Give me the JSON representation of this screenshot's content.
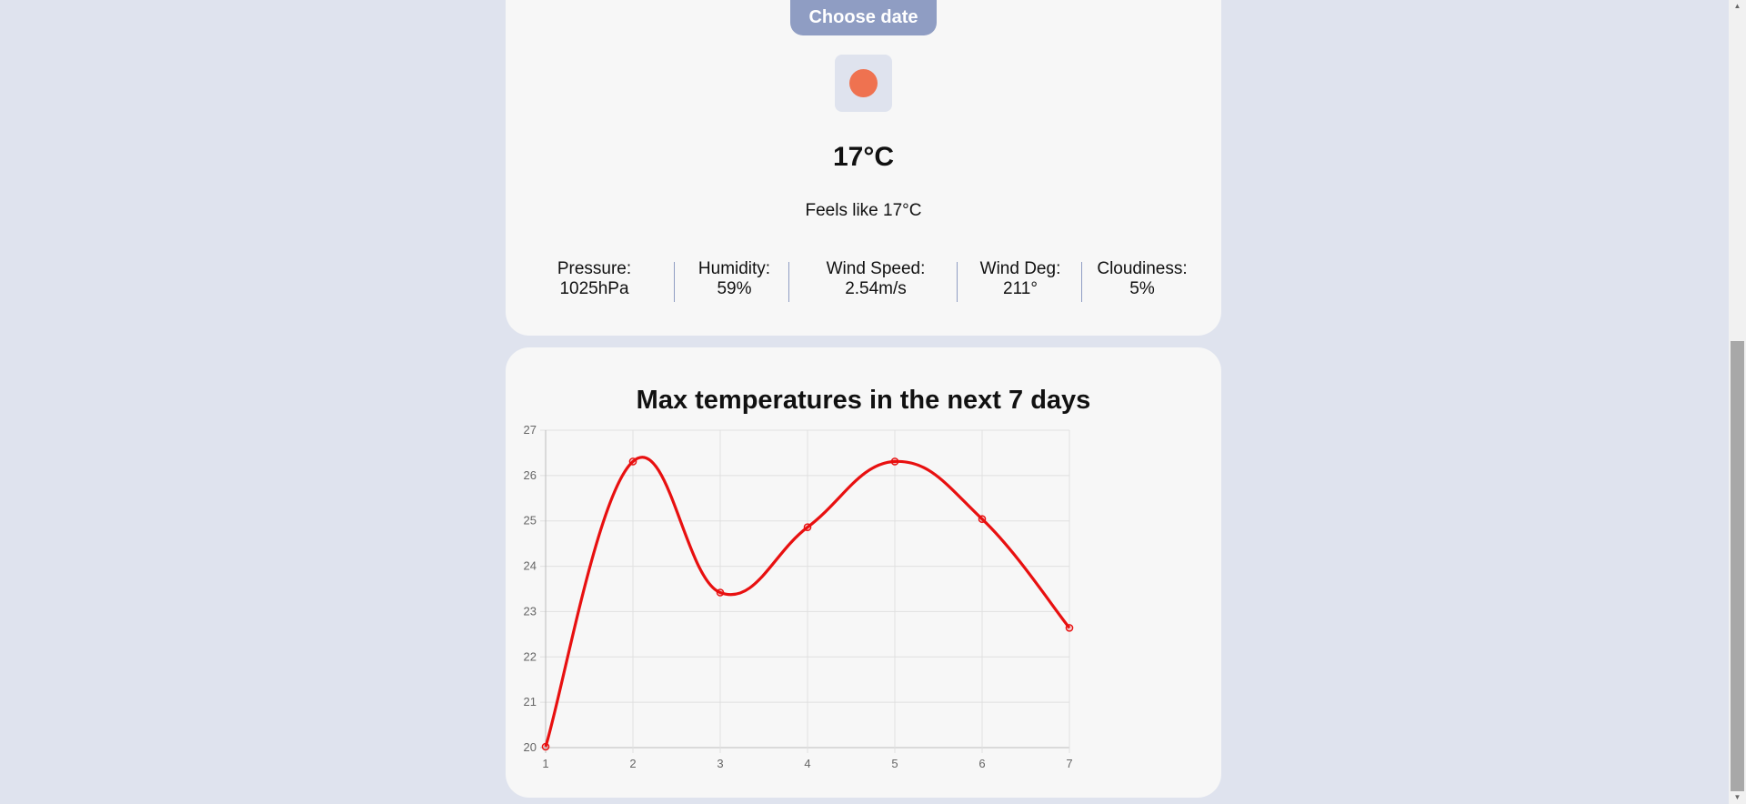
{
  "weather": {
    "choose_date_label": "Choose date",
    "icon": "sun-icon",
    "icon_color": "#ef7250",
    "temperature": "17°C",
    "feels_like": "Feels like 17°C",
    "stats": [
      {
        "label": "Pressure:",
        "value": "1025hPa"
      },
      {
        "label": "Humidity:",
        "value": "59%"
      },
      {
        "label": "Wind Speed:",
        "value": "2.54m/s"
      },
      {
        "label": "Wind Deg:",
        "value": "211°"
      },
      {
        "label": "Cloudiness:",
        "value": "5%"
      }
    ]
  },
  "colors": {
    "background": "#dfe3ee",
    "card": "#f7f7f7",
    "button": "#8f9dc3",
    "line": "#e81010"
  },
  "chart_data": {
    "type": "line",
    "title": "Max temperatures in the next 7 days",
    "xlabel": "",
    "ylabel": "",
    "x": [
      1,
      2,
      3,
      4,
      5,
      6,
      7
    ],
    "series": [
      {
        "values": [
          20.02,
          26.31,
          23.42,
          24.86,
          26.31,
          25.04,
          22.64
        ]
      }
    ],
    "ylim": [
      20,
      27
    ],
    "yticks": [
      20,
      21,
      22,
      23,
      24,
      25,
      26,
      27
    ],
    "grid": true,
    "color": "#e81010"
  }
}
